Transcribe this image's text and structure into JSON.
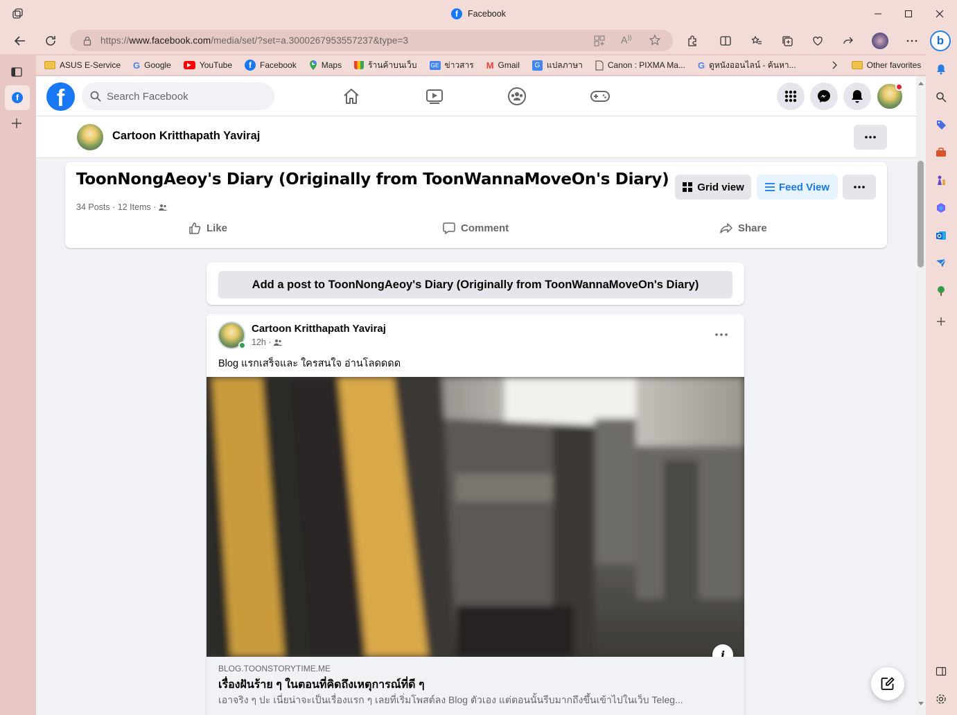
{
  "browser": {
    "tab_title": "Facebook",
    "url_prefix": "https://",
    "url_domain": "www.facebook.com",
    "url_path": "/media/set/?set=a.3000267953557237&type=3"
  },
  "bookmarks": [
    {
      "label": "ASUS E-Service",
      "icon": "folder-icon"
    },
    {
      "label": "Google",
      "icon": "google-icon"
    },
    {
      "label": "YouTube",
      "icon": "youtube-icon"
    },
    {
      "label": "Facebook",
      "icon": "facebook-icon"
    },
    {
      "label": "Maps",
      "icon": "maps-icon"
    },
    {
      "label": "ร้านค้าบนเว็บ",
      "icon": "webstore-icon"
    },
    {
      "label": "ข่าวสาร",
      "icon": "news-icon"
    },
    {
      "label": "Gmail",
      "icon": "gmail-icon"
    },
    {
      "label": "แปลภาษา",
      "icon": "translate-icon"
    },
    {
      "label": "Canon : PIXMA Ma...",
      "icon": "page-icon"
    },
    {
      "label": "ดูหนังออนไลน์ - ค้นหา...",
      "icon": "google-icon"
    }
  ],
  "bookmarks_other": "Other favorites",
  "fb": {
    "search_placeholder": "Search Facebook",
    "profile_name": "Cartoon Kritthapath Yaviraj"
  },
  "album": {
    "title": "ToonNongAeoy's Diary (Originally from ToonWannaMoveOn's Diary)",
    "meta": "34 Posts · 12 Items ·",
    "grid_view_label": "Grid view",
    "feed_view_label": "Feed View",
    "like_label": "Like",
    "comment_label": "Comment",
    "share_label": "Share"
  },
  "add_post": {
    "label": "Add a post to ToonNongAeoy's Diary (Originally from ToonWannaMoveOn's Diary)"
  },
  "post": {
    "author": "Cartoon Kritthapath Yaviraj",
    "time": "12h ·",
    "text": "Blog แรกเสร็จและ ใครสนใจ อ่านโลดดดด",
    "link_domain": "BLOG.TOONSTORYTIME.ME",
    "link_title": "เรื่องฝันร้าย ๆ ในตอนที่คิดถึงเหตุการณ์ที่ดี ๆ",
    "link_desc": "เอาจริง ๆ ปะ เนี่ยน่าจะเป็นเรื่องแรก ๆ เลยที่เริ่มโพสต์ลง Blog ตัวเอง แต่ตอนนั้นรีบมากถึงขึ้นเข้าไปในเว็บ Teleg..."
  },
  "colors": {
    "fb_blue": "#1877f2",
    "browser_frame": "#f3dcd8",
    "page_bg": "#f0f2f5"
  }
}
